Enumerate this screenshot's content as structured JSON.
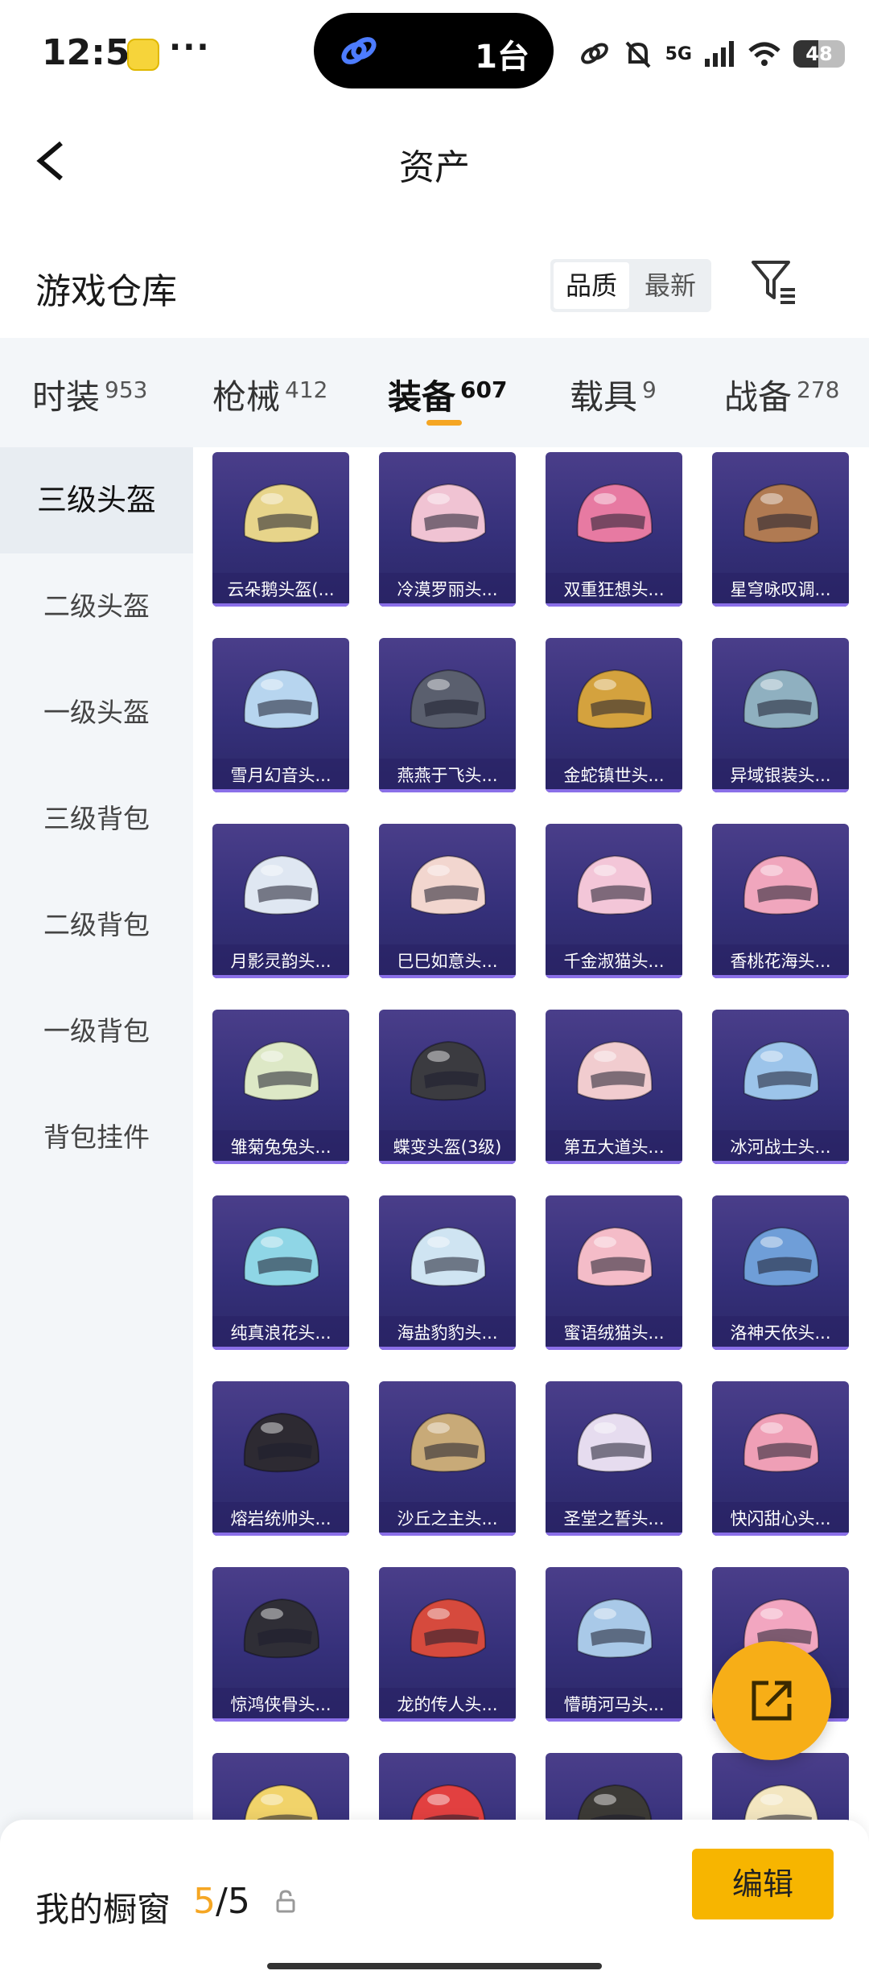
{
  "status_bar": {
    "time": "12:51",
    "island_count": "1台",
    "network": "5G",
    "battery": "48"
  },
  "nav": {
    "title": "资产"
  },
  "warehouse": {
    "title": "游戏仓库",
    "sort_options": [
      "品质",
      "最新"
    ]
  },
  "tabs": [
    {
      "label": "时装",
      "count": "953"
    },
    {
      "label": "枪械",
      "count": "412"
    },
    {
      "label": "装备",
      "count": "607",
      "active": true
    },
    {
      "label": "载具",
      "count": "9"
    },
    {
      "label": "战备",
      "count": "278"
    }
  ],
  "sidebar": [
    {
      "label": "三级头盔",
      "active": true
    },
    {
      "label": "二级头盔"
    },
    {
      "label": "一级头盔"
    },
    {
      "label": "三级背包"
    },
    {
      "label": "二级背包"
    },
    {
      "label": "一级背包"
    },
    {
      "label": "背包挂件"
    }
  ],
  "items": [
    {
      "name": "云朵鹅头盔(...",
      "color": "#e7d48a"
    },
    {
      "name": "冷漠罗丽头...",
      "color": "#f0c3d3"
    },
    {
      "name": "双重狂想头...",
      "color": "#e77aa2"
    },
    {
      "name": "星穹咏叹调...",
      "color": "#b07a52"
    },
    {
      "name": "雪月幻音头...",
      "color": "#b7d5ef"
    },
    {
      "name": "燕燕于飞头...",
      "color": "#5a5f6e"
    },
    {
      "name": "金蛇镇世头...",
      "color": "#d4a23e"
    },
    {
      "name": "异域银装头...",
      "color": "#8fb0c0"
    },
    {
      "name": "月影灵韵头...",
      "color": "#dfe7f2"
    },
    {
      "name": "巳巳如意头...",
      "color": "#f2d6cf"
    },
    {
      "name": "千金淑猫头...",
      "color": "#f3c6d8"
    },
    {
      "name": "香桃花海头...",
      "color": "#f0a6bd"
    },
    {
      "name": "雏菊兔兔头...",
      "color": "#dde8c6"
    },
    {
      "name": "蝶变头盔(3级)",
      "color": "#3b3b40"
    },
    {
      "name": "第五大道头...",
      "color": "#f1cccf"
    },
    {
      "name": "冰河战士头...",
      "color": "#9cc4ea"
    },
    {
      "name": "纯真浪花头...",
      "color": "#8fd6e6"
    },
    {
      "name": "海盐豹豹头...",
      "color": "#cfe4f2"
    },
    {
      "name": "蜜语绒猫头...",
      "color": "#f4bcc8"
    },
    {
      "name": "洛神天依头...",
      "color": "#6f9ed8"
    },
    {
      "name": "熔岩统帅头...",
      "color": "#2d2a32"
    },
    {
      "name": "沙丘之主头...",
      "color": "#c8aa78"
    },
    {
      "name": "圣堂之誓头...",
      "color": "#e6dcef"
    },
    {
      "name": "快闪甜心头...",
      "color": "#ef9fb6"
    },
    {
      "name": "惊鸿侠骨头...",
      "color": "#2f2e36"
    },
    {
      "name": "龙的传人头...",
      "color": "#d64a3d"
    },
    {
      "name": "懵萌河马头...",
      "color": "#a9c9e8"
    },
    {
      "name": "",
      "color": "#f2a6c0"
    },
    {
      "name": "",
      "color": "#f1d36a"
    },
    {
      "name": "",
      "color": "#e24040"
    },
    {
      "name": "",
      "color": "#3c3a36"
    },
    {
      "name": "",
      "color": "#f3e6c0"
    }
  ],
  "bottom": {
    "label": "我的橱窗",
    "current": "5",
    "total": "/5",
    "edit_label": "编辑"
  },
  "colors": {
    "accent": "#f5a623",
    "card_bg": "#35307a"
  }
}
